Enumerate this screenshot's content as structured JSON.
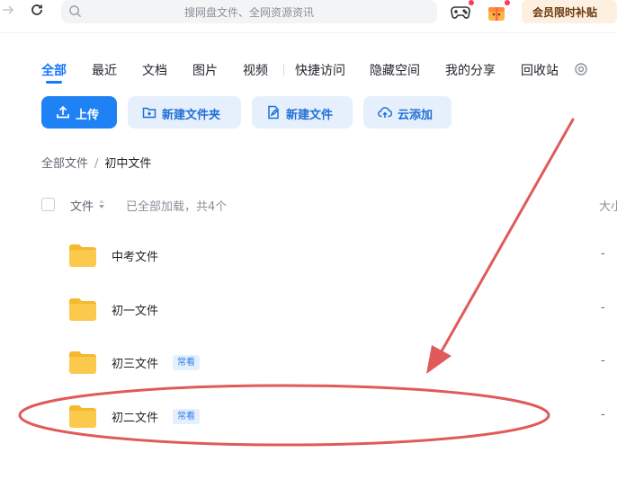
{
  "topbar": {
    "forward_icon": "arrow-right-icon",
    "refresh_icon": "refresh-icon",
    "search_placeholder": "搜网盘文件、全网资源资讯",
    "game_icon": "gamepad-icon",
    "gift_icon": "gift-icon",
    "vip_label": "会员限时补贴"
  },
  "tabs": [
    {
      "label": "全部",
      "active": true
    },
    {
      "label": "最近"
    },
    {
      "label": "文档"
    },
    {
      "label": "图片"
    },
    {
      "label": "视频"
    },
    {
      "label": "快捷访问"
    },
    {
      "label": "隐藏空间"
    },
    {
      "label": "我的分享"
    },
    {
      "label": "回收站"
    }
  ],
  "actions": {
    "upload": "上传",
    "new_folder": "新建文件夹",
    "new_file": "新建文件",
    "cloud_add": "云添加"
  },
  "breadcrumb": {
    "root": "全部文件",
    "separator": "/",
    "current": "初中文件"
  },
  "table": {
    "header_name": "文件",
    "loaded_text": "已全部加载，共4个",
    "header_size": "大小"
  },
  "files": [
    {
      "name": "中考文件",
      "tag": "",
      "size": "-"
    },
    {
      "name": "初一文件",
      "tag": "",
      "size": "-"
    },
    {
      "name": "初三文件",
      "tag": "常看",
      "size": "-"
    },
    {
      "name": "初二文件",
      "tag": "常看",
      "size": "-"
    }
  ],
  "annotation": {
    "color": "#e05a5a",
    "highlighted_item": "初二文件"
  },
  "colors": {
    "accent": "#1677ff",
    "folder": "#fbc94b"
  }
}
